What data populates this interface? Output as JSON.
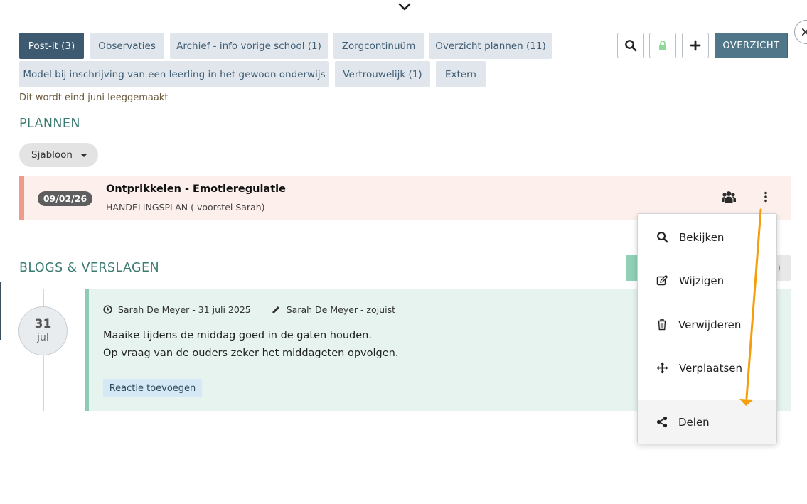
{
  "tabs": [
    {
      "label": "Post-it (3)",
      "active": true
    },
    {
      "label": "Observaties"
    },
    {
      "label": "Archief - info vorige school (1)"
    },
    {
      "label": "Zorgcontinuüm"
    },
    {
      "label": "Overzicht plannen (11)"
    },
    {
      "label": "Model bij inschrijving van een leerling in het gewoon onderwijs"
    },
    {
      "label": "Vertrouwelijk (1)"
    },
    {
      "label": "Extern"
    }
  ],
  "toolbar": {
    "overzicht_label": "OVERZICHT"
  },
  "note": "Dit wordt eind juni leeggemaakt",
  "plannen": {
    "title": "PLANNEN",
    "sjabloon_label": "Sjabloon",
    "plan": {
      "date": "09/02/26",
      "title": "Ontprikkelen - Emotieregulatie",
      "subtitle": "HANDELINGSPLAN ( voorstel Sarah)"
    }
  },
  "blogs": {
    "title": "BLOGS & VERSLAGEN",
    "hidden_button_text": ")",
    "entry": {
      "day": "31",
      "month": "jul",
      "author_created": "Sarah De Meyer - 31 juli 2025",
      "author_edited": "Sarah De Meyer - zojuist",
      "line1": "Maaike tijdens de middag goed in de gaten houden.",
      "line2": "Op vraag van de ouders zeker het middageten opvolgen.",
      "reactie_label": "Reactie toevoegen"
    }
  },
  "menu": {
    "items": [
      {
        "label": "Bekijken",
        "icon": "search-icon"
      },
      {
        "label": "Wijzigen",
        "icon": "edit-icon"
      },
      {
        "label": "Verwijderen",
        "icon": "trash-icon"
      },
      {
        "label": "Verplaatsen",
        "icon": "move-icon"
      },
      {
        "label": "Delen",
        "icon": "share-icon"
      }
    ]
  },
  "colors": {
    "accent": "#3d5a70",
    "section_title": "#3b7b72",
    "plan_border": "#ee9b8d",
    "blog_border": "#8dcbb4",
    "arrow": "#f59e0b"
  }
}
